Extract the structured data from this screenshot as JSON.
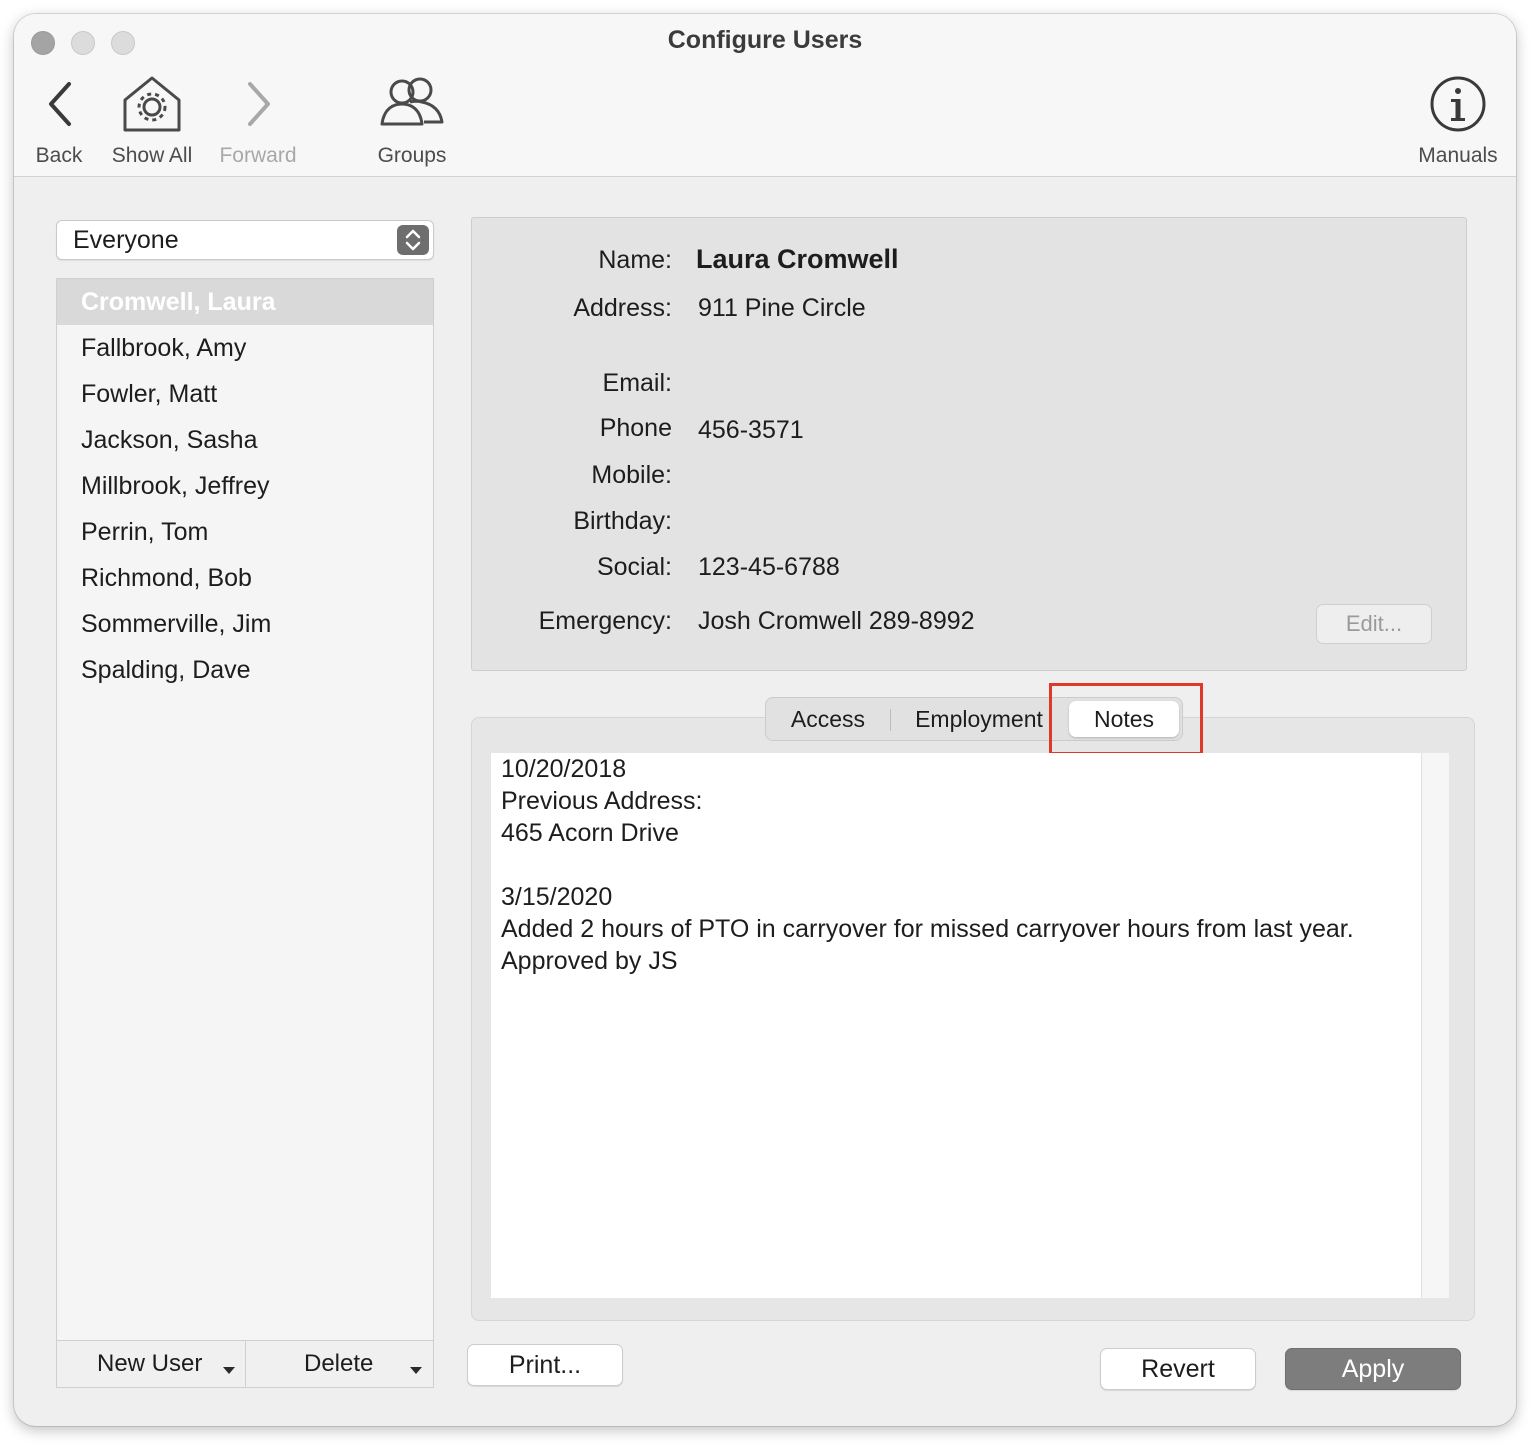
{
  "window": {
    "title": "Configure Users"
  },
  "toolbar": {
    "back_label": "Back",
    "show_all_label": "Show All",
    "forward_label": "Forward",
    "groups_label": "Groups",
    "manuals_label": "Manuals"
  },
  "filter": {
    "selected": "Everyone"
  },
  "users": [
    "Cromwell, Laura",
    "Fallbrook, Amy",
    "Fowler, Matt",
    "Jackson, Sasha",
    "Millbrook, Jeffrey",
    "Perrin, Tom",
    "Richmond, Bob",
    "Sommerville, Jim",
    "Spalding, Dave"
  ],
  "user_list_bar": {
    "new_user_label": "New User",
    "delete_label": "Delete"
  },
  "details": {
    "name_label": "Name:",
    "name_value": "Laura Cromwell",
    "address_label": "Address:",
    "address_value": "911 Pine Circle",
    "email_label": "Email:",
    "email_value": "",
    "phone_label": "Phone",
    "phone_value": "456-3571",
    "mobile_label": "Mobile:",
    "mobile_value": "",
    "birthday_label": "Birthday:",
    "birthday_value": "",
    "social_label": "Social:",
    "social_value": "123-45-6788",
    "emergency_label": "Emergency:",
    "emergency_value": "Josh Cromwell  289-8992",
    "edit_label": "Edit..."
  },
  "tabs": [
    {
      "label": "Access"
    },
    {
      "label": "Employment"
    },
    {
      "label": "Notes",
      "selected": true
    }
  ],
  "notes": [
    "10/20/2018",
    "Previous Address:",
    "465 Acorn Drive",
    "",
    "3/15/2020",
    "Added 2 hours of PTO in carryover for missed carryover hours from last year. Approved by JS"
  ],
  "buttons": {
    "print_label": "Print...",
    "revert_label": "Revert",
    "apply_label": "Apply"
  },
  "colors": {
    "highlight": "#e0392b",
    "selection": "#d9d9d9",
    "apply_button": "#7d7d7d"
  }
}
